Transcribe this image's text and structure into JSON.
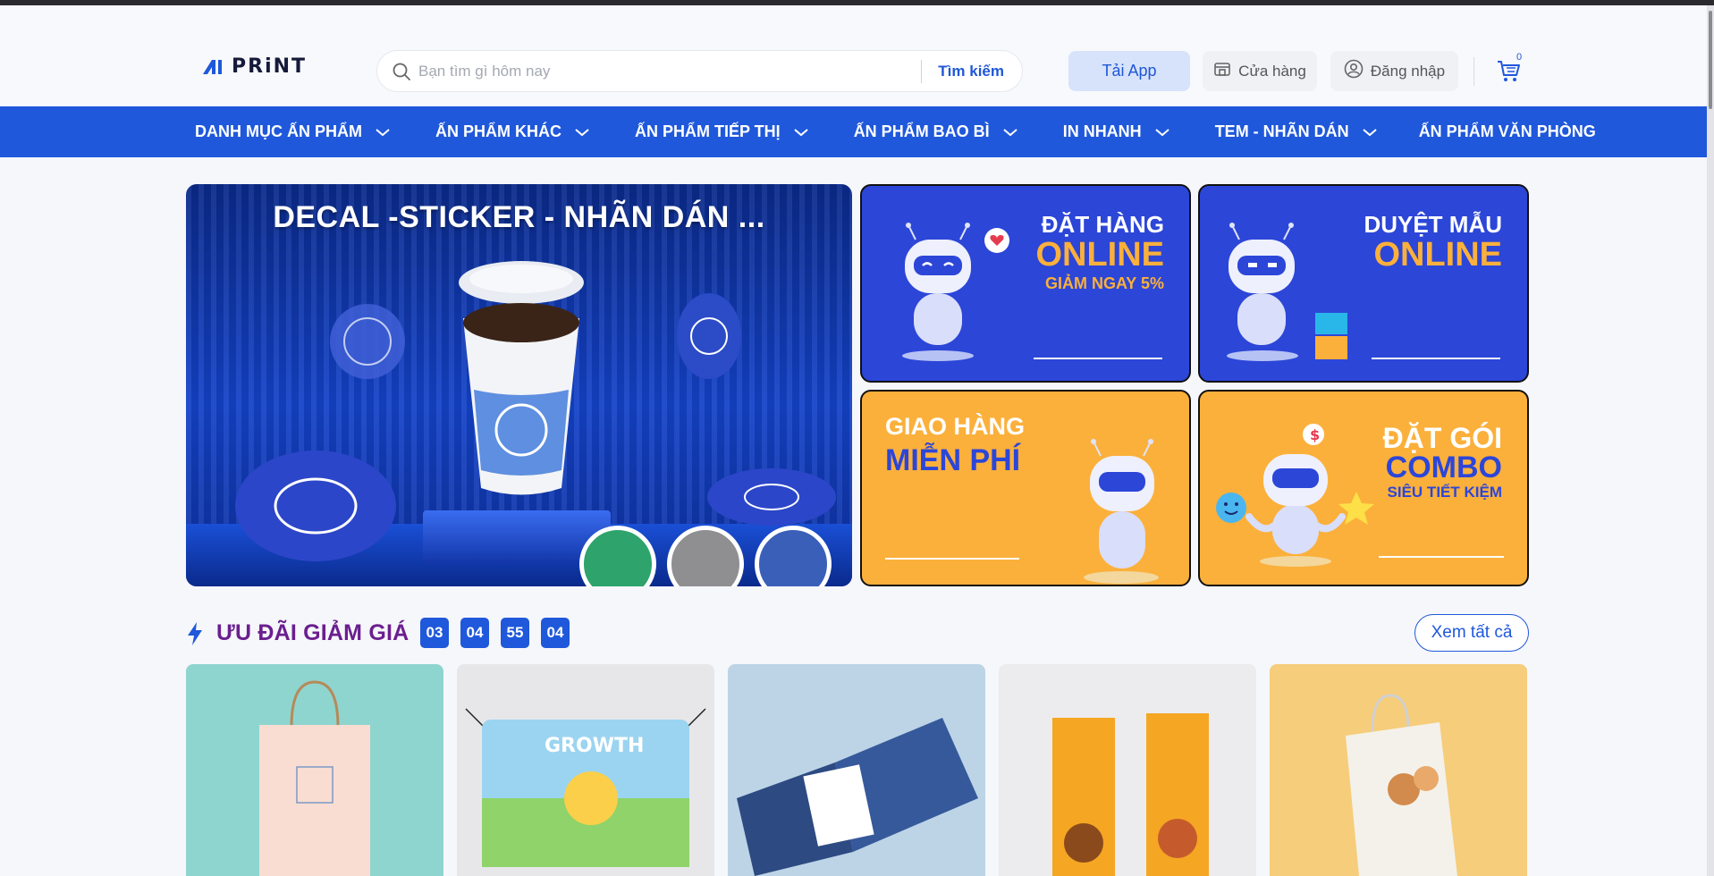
{
  "header": {
    "logo_text": "PRiNT",
    "search": {
      "placeholder": "Bạn tìm gì hôm nay",
      "button_label": "Tìm kiếm"
    },
    "app_button": "Tải App",
    "store_button": "Cửa hàng",
    "login_button": "Đăng nhập",
    "cart_count": "0"
  },
  "nav": {
    "items": [
      {
        "label": "DANH MỤC ẤN PHẨM"
      },
      {
        "label": "ẤN PHẨM KHÁC"
      },
      {
        "label": "ẤN PHẨM TIẾP THỊ"
      },
      {
        "label": "ẤN PHẨM BAO BÌ"
      },
      {
        "label": "IN NHANH"
      },
      {
        "label": "TEM - NHÃN DÁN"
      },
      {
        "label": "ẤN PHẨM VĂN PHÒNG"
      }
    ]
  },
  "hero": {
    "title": "DECAL -STICKER - NHÃN DÁN ..."
  },
  "promos": [
    {
      "line1": "ĐẶT HÀNG",
      "line2": "ONLINE",
      "line3": "GIẢM NGAY 5%"
    },
    {
      "line1": "DUYỆT MẪU",
      "line2": "ONLINE"
    },
    {
      "line1": "GIAO HÀNG",
      "line2": "MIỄN PHÍ"
    },
    {
      "line1": "ĐẶT GÓI",
      "line2": "COMBO",
      "line3": "SIÊU TIẾT KIỆM"
    }
  ],
  "deals": {
    "title": "ƯU ĐÃI GIẢM GIÁ",
    "timer": [
      "03",
      "04",
      "55",
      "04"
    ],
    "see_all": "Xem tất cả"
  },
  "product_images": [
    "paper-bag",
    "growth-banner",
    "presentation-folder",
    "food-menu-standee",
    "bakery-paper-bag"
  ],
  "colors": {
    "brand_blue": "#1f58db",
    "promo_blue": "#2c46d8",
    "promo_orange": "#fbb03b",
    "accent_yellow": "#fbb03b",
    "deals_title": "#6b1f8f"
  }
}
